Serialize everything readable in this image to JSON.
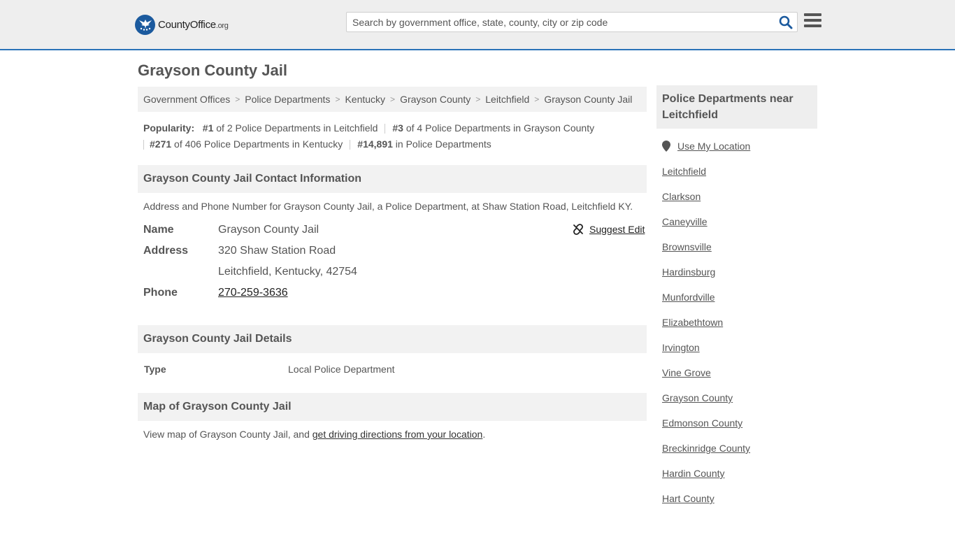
{
  "header": {
    "logo_text_main": "CountyOffice",
    "logo_text_tld": ".org",
    "search_placeholder": "Search by government office, state, county, city or zip code",
    "search_value": "",
    "icons": {
      "search": "search-icon",
      "menu": "hamburger-menu-icon",
      "logo": "eagle-logo-icon"
    }
  },
  "page": {
    "title": "Grayson County Jail"
  },
  "breadcrumb": [
    {
      "label": "Government Offices"
    },
    {
      "label": "Police Departments"
    },
    {
      "label": "Kentucky"
    },
    {
      "label": "Grayson County"
    },
    {
      "label": "Leitchfield"
    },
    {
      "label": "Grayson County Jail"
    }
  ],
  "breadcrumb_separator": ">",
  "popularity": {
    "label": "Popularity:",
    "items": [
      {
        "rank": "#1",
        "text": " of 2 Police Departments in Leitchfield"
      },
      {
        "rank": "#3",
        "text": " of 4 Police Departments in Grayson County"
      },
      {
        "rank": "#271",
        "text": " of 406 Police Departments in Kentucky"
      },
      {
        "rank": "#14,891",
        "text": " in Police Departments"
      }
    ]
  },
  "contact": {
    "heading": "Grayson County Jail Contact Information",
    "description": "Address and Phone Number for Grayson County Jail, a Police Department, at Shaw Station Road, Leitchfield KY.",
    "name_label": "Name",
    "name_value": "Grayson County Jail",
    "address_label": "Address",
    "address_line1": "320 Shaw Station Road",
    "address_line2": "Leitchfield, Kentucky, 42754",
    "phone_label": "Phone",
    "phone_value": "270-259-3636",
    "suggest_edit": "Suggest Edit"
  },
  "details": {
    "heading": "Grayson County Jail Details",
    "type_label": "Type",
    "type_value": "Local Police Department"
  },
  "map": {
    "heading": "Map of Grayson County Jail",
    "text_before": "View map of Grayson County Jail, and ",
    "link_text": "get driving directions from your location",
    "text_after": "."
  },
  "sidebar": {
    "heading": "Police Departments near Leitchfield",
    "use_location": "Use My Location",
    "links": [
      "Leitchfield",
      "Clarkson",
      "Caneyville",
      "Brownsville",
      "Hardinsburg",
      "Munfordville",
      "Elizabethtown",
      "Irvington",
      "Vine Grove",
      "Grayson County",
      "Edmonson County",
      "Breckinridge County",
      "Hardin County",
      "Hart County"
    ]
  },
  "colors": {
    "accent": "#2a72b8",
    "logo_blue": "#1b5a9e",
    "panel_bg": "#f2f2f2",
    "header_bg": "#eeeeee"
  }
}
